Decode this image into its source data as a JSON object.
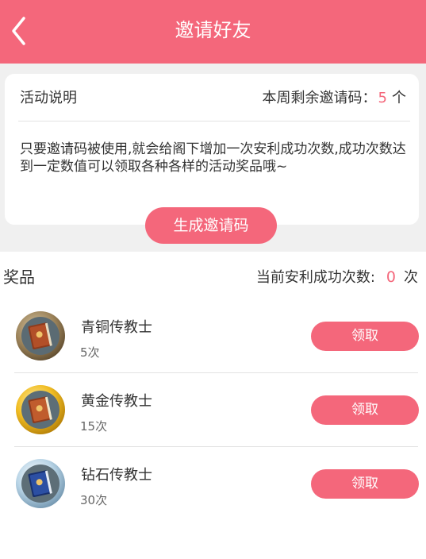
{
  "header": {
    "title": "邀请好友"
  },
  "activity": {
    "label": "活动说明",
    "remaining_label": "本周剩余邀请码：",
    "remaining_count": "5",
    "remaining_unit": "个",
    "description": "只要邀请码被使用,就会给阁下增加一次安利成功次数,成功次数达到一定数值可以领取各种各样的活动奖品哦~",
    "generate_button": "生成邀请码"
  },
  "prizes": {
    "title": "奖品",
    "success_label": "当前安利成功次数:",
    "success_count": "0",
    "success_unit": "次",
    "items": [
      {
        "name": "青铜传教士",
        "requirement": "5次",
        "button": "领取",
        "icon": "bronze-book-medal",
        "ring_color": "#9a8158"
      },
      {
        "name": "黄金传教士",
        "requirement": "15次",
        "button": "领取",
        "icon": "gold-book-medal",
        "ring_color": "#e8b21e"
      },
      {
        "name": "钻石传教士",
        "requirement": "30次",
        "button": "领取",
        "icon": "diamond-book-medal",
        "ring_color": "#b8d4e6"
      }
    ]
  },
  "colors": {
    "accent": "#f4677b",
    "background": "#f0f0f0"
  }
}
